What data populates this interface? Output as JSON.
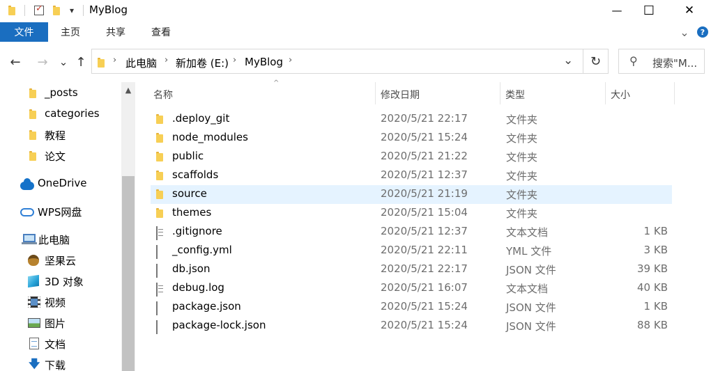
{
  "window": {
    "title": "MyBlog",
    "quick_access_dropdown": "▾",
    "minimize": "—",
    "maximize": "☐",
    "close": "✕"
  },
  "ribbon": {
    "tabs": [
      {
        "label": "文件",
        "active": true
      },
      {
        "label": "主页",
        "active": false
      },
      {
        "label": "共享",
        "active": false
      },
      {
        "label": "查看",
        "active": false
      }
    ],
    "expand_glyph": "⌄",
    "help_glyph": "?"
  },
  "navigation": {
    "back": "←",
    "forward": "→",
    "recent": "⌄",
    "up": "↑",
    "address": [
      {
        "label": "此电脑"
      },
      {
        "label": "新加卷 (E:)"
      },
      {
        "label": "MyBlog"
      }
    ],
    "separator": "›",
    "dropdown": "⌄",
    "refresh": "↻",
    "search_glyph": "⚲",
    "search_placeholder": "搜索\"M..."
  },
  "sidebar": {
    "scroll_up": "▲",
    "items": [
      {
        "label": "_posts",
        "icon": "folder-icon"
      },
      {
        "label": "categories",
        "icon": "folder-icon"
      },
      {
        "label": "教程",
        "icon": "folder-icon"
      },
      {
        "label": "论文",
        "icon": "folder-icon"
      },
      {
        "label": "OneDrive",
        "icon": "onedrive-icon"
      },
      {
        "label": "WPS网盘",
        "icon": "wps-cloud-icon"
      },
      {
        "label": "此电脑",
        "icon": "computer-icon"
      },
      {
        "label": "坚果云",
        "icon": "nut-icon"
      },
      {
        "label": "3D 对象",
        "icon": "cube-icon"
      },
      {
        "label": "视频",
        "icon": "video-icon"
      },
      {
        "label": "图片",
        "icon": "picture-icon"
      },
      {
        "label": "文档",
        "icon": "document-icon"
      },
      {
        "label": "下载",
        "icon": "download-icon"
      }
    ]
  },
  "file_list": {
    "sort_glyph": "^",
    "columns": {
      "name": "名称",
      "date": "修改日期",
      "type": "类型",
      "size": "大小"
    },
    "rows": [
      {
        "name": ".deploy_git",
        "date": "2020/5/21 22:17",
        "type": "文件夹",
        "size": "",
        "kind": "folder"
      },
      {
        "name": "node_modules",
        "date": "2020/5/21 15:24",
        "type": "文件夹",
        "size": "",
        "kind": "folder"
      },
      {
        "name": "public",
        "date": "2020/5/21 21:22",
        "type": "文件夹",
        "size": "",
        "kind": "folder"
      },
      {
        "name": "scaffolds",
        "date": "2020/5/21 12:37",
        "type": "文件夹",
        "size": "",
        "kind": "folder"
      },
      {
        "name": "source",
        "date": "2020/5/21 21:19",
        "type": "文件夹",
        "size": "",
        "kind": "folder",
        "selected": true
      },
      {
        "name": "themes",
        "date": "2020/5/21 15:04",
        "type": "文件夹",
        "size": "",
        "kind": "folder"
      },
      {
        "name": ".gitignore",
        "date": "2020/5/21 12:37",
        "type": "文本文档",
        "size": "1 KB",
        "kind": "text"
      },
      {
        "name": "_config.yml",
        "date": "2020/5/21 22:11",
        "type": "YML 文件",
        "size": "3 KB",
        "kind": "file"
      },
      {
        "name": "db.json",
        "date": "2020/5/21 22:17",
        "type": "JSON 文件",
        "size": "39 KB",
        "kind": "file"
      },
      {
        "name": "debug.log",
        "date": "2020/5/21 16:07",
        "type": "文本文档",
        "size": "40 KB",
        "kind": "text"
      },
      {
        "name": "package.json",
        "date": "2020/5/21 15:24",
        "type": "JSON 文件",
        "size": "1 KB",
        "kind": "file"
      },
      {
        "name": "package-lock.json",
        "date": "2020/5/21 15:24",
        "type": "JSON 文件",
        "size": "88 KB",
        "kind": "file"
      }
    ]
  }
}
